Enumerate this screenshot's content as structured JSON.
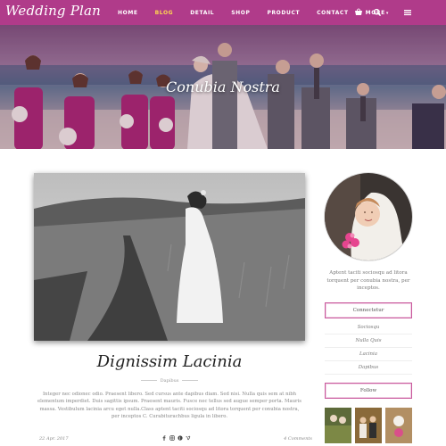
{
  "nav": {
    "logo": "Wedding Plan",
    "menu": [
      {
        "label": "HOME",
        "active": false
      },
      {
        "label": "BLOG",
        "active": true
      },
      {
        "label": "DETAIL",
        "active": false
      },
      {
        "label": "SHOP",
        "active": false
      },
      {
        "label": "PRODUCT",
        "active": false
      },
      {
        "label": "CONTACT",
        "active": false
      },
      {
        "label": "MORE",
        "active": false
      }
    ],
    "icons": [
      "shopping-cart-icon",
      "search-icon",
      "menu-icon"
    ],
    "color": "#b03b8a",
    "active_color": "#ffd84f"
  },
  "hero": {
    "title": "Conubia Nostra"
  },
  "post": {
    "title": "Dignissim Lacinia",
    "category": "Dapibus",
    "body": "Integer nec odionec odio. Praesent libero. Sed cursus ante dapibus diam. Sed nisi. Nulla quis sem at nibh elementum imperdiet. Duis sagittis ipsum. Praesent mauris. Fusce nec tellus sed augue semper porta. Mauris massa. Vestibulum lacinia arcu eget nulla.Class aptent taciti sociosqu ad litora torquent per conubia nostra, per inceptos C. Curabiturachbus ligula in libero.",
    "date": "22 Apr. 2017",
    "comments": "4 Comments",
    "social_icons": [
      "facebook-icon",
      "instagram-icon",
      "pinterest-icon",
      "vimeo-icon"
    ]
  },
  "sidebar": {
    "about": "Aptent taciti sociosqu ad litora torquent per conubia nostra, per inceptos.",
    "connect_label": "Connectetur",
    "links": [
      "Sociosqu",
      "Nulla Quis",
      "Lacinia",
      "Dapibus"
    ],
    "follow_label": "Follow"
  }
}
